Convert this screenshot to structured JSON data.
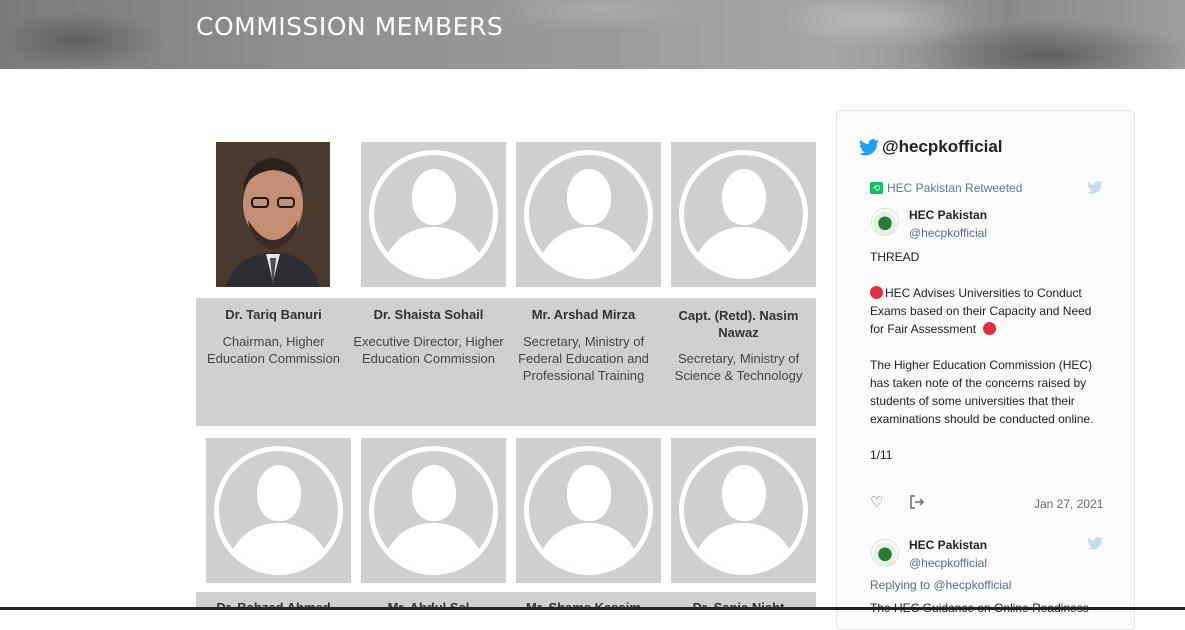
{
  "banner": {
    "title": "COMMISSION MEMBERS"
  },
  "members_row1": [
    {
      "name": "Dr. Tariq Banuri",
      "role": "Chairman, Higher Education Commission",
      "photo": "portrait"
    },
    {
      "name": "Dr. Shaista Sohail",
      "role": "Executive Director, Higher Education Commission",
      "photo": "placeholder"
    },
    {
      "name": "Mr. Arshad Mirza",
      "role": "Secretary, Ministry of Federal Education and Professional Training",
      "photo": "placeholder"
    },
    {
      "name": "Capt. (Retd). Nasim Nawaz",
      "role": "Secretary, Ministry of Science & Technology",
      "photo": "placeholder"
    }
  ],
  "members_row2": [
    {
      "name": "Dr. Bahzad Ahmed",
      "photo": "placeholder"
    },
    {
      "name": "Mr. Abdul Sal",
      "photo": "placeholder"
    },
    {
      "name": "Mr. Shams Kassim",
      "photo": "placeholder"
    },
    {
      "name": "Dr. Sania Nisht",
      "photo": "placeholder"
    }
  ],
  "twitter": {
    "handle": "@hecpkofficial",
    "retweet_label": "HEC Pakistan Retweeted",
    "tweet1": {
      "author": "HEC Pakistan",
      "handle": "@hecpkofficial",
      "line1": "THREAD",
      "line2": "HEC Advises Universities to Conduct Exams based on their Capacity and Need for Fair Assessment",
      "line3": "The Higher Education Commission (HEC) has taken note of the concerns raised by students of some universities that their examinations should be conducted online.",
      "line4": "1/11",
      "date": "Jan 27, 2021"
    },
    "tweet2": {
      "author": "HEC Pakistan",
      "handle": "@hecpkofficial",
      "replying": "Replying to @hecpkofficial",
      "line1": "The HEC Guidance on Online Readiness"
    }
  },
  "colors": {
    "twitter_blue": "#1da1f2",
    "retweet_green": "#17bf63",
    "emoji_red": "#dd2e44",
    "card_grey": "#d0d0d0"
  }
}
